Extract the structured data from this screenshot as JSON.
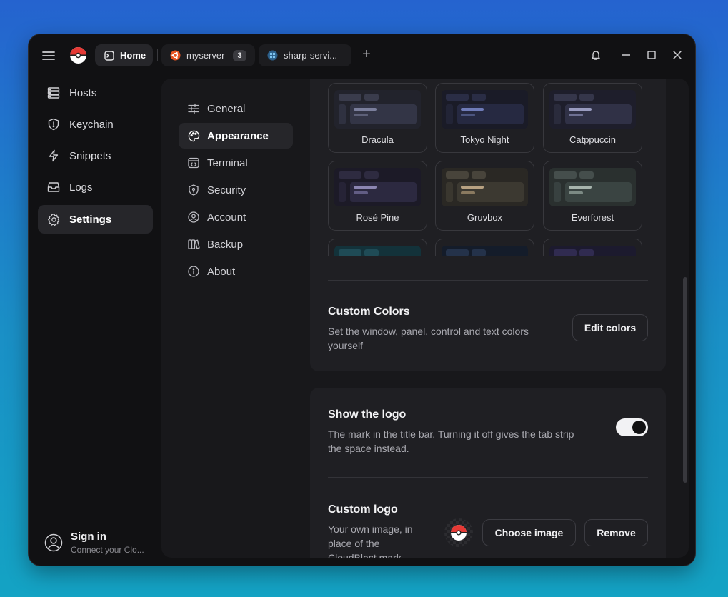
{
  "titlebar": {
    "tabs": [
      {
        "label": "Home",
        "icon": "terminal-square-icon"
      },
      {
        "label": "myserver",
        "icon": "ubuntu-icon",
        "badge": "3"
      },
      {
        "label": "sharp-servi...",
        "icon": "windows-icon"
      }
    ],
    "add_tab": "+"
  },
  "sidebar": {
    "items": [
      {
        "label": "Hosts",
        "icon": "server-icon"
      },
      {
        "label": "Keychain",
        "icon": "shield-icon"
      },
      {
        "label": "Snippets",
        "icon": "lightning-icon"
      },
      {
        "label": "Logs",
        "icon": "inbox-icon"
      },
      {
        "label": "Settings",
        "icon": "gear-icon",
        "active": true
      }
    ],
    "signin": {
      "title": "Sign in",
      "subtitle": "Connect your Clo..."
    }
  },
  "settings_nav": {
    "items": [
      {
        "label": "General",
        "icon": "sliders-icon"
      },
      {
        "label": "Appearance",
        "icon": "palette-icon",
        "active": true
      },
      {
        "label": "Terminal",
        "icon": "code-window-icon"
      },
      {
        "label": "Security",
        "icon": "shield-lock-icon"
      },
      {
        "label": "Account",
        "icon": "user-circle-icon"
      },
      {
        "label": "Backup",
        "icon": "book-icon"
      },
      {
        "label": "About",
        "icon": "info-icon"
      }
    ]
  },
  "themes": [
    {
      "name": "Dracula",
      "bg": "#22232c",
      "pill": "#3a3c4c",
      "side": "#2f3140",
      "content": "#333546",
      "line1": "#7b7f9c",
      "line2": "#5d6078"
    },
    {
      "name": "Tokyo Night",
      "bg": "#1a1b27",
      "pill": "#2a2d45",
      "side": "#222436",
      "content": "#262941",
      "line1": "#6f7bb7",
      "line2": "#4c557f"
    },
    {
      "name": "Catppuccin",
      "bg": "#1e1e2b",
      "pill": "#35364a",
      "side": "#2a2b3c",
      "content": "#303146",
      "line1": "#9a9cc0",
      "line2": "#6e7092"
    },
    {
      "name": "Rosé Pine",
      "bg": "#1c1a27",
      "pill": "#2e2b40",
      "side": "#262336",
      "content": "#2c2940",
      "line1": "#8c86b2",
      "line2": "#625d84"
    },
    {
      "name": "Gruvbox",
      "bg": "#2a2824",
      "pill": "#48443b",
      "side": "#3a372f",
      "content": "#3c3931",
      "line1": "#b8a282",
      "line2": "#8a7a60"
    },
    {
      "name": "Everforest",
      "bg": "#2a302f",
      "pill": "#454e4c",
      "side": "#384140",
      "content": "#3a4442",
      "line1": "#a7b4ad",
      "line2": "#7c8a84"
    },
    {
      "name": "",
      "bg": "#13323a",
      "pill": "#1f4b56",
      "side": "#19404a",
      "content": "#1d4550",
      "line1": "#4b8a96",
      "line2": "#366a74"
    },
    {
      "name": "",
      "bg": "#141c2a",
      "pill": "#24324a",
      "side": "#1c283c",
      "content": "#202c42",
      "line1": "#4d6a99",
      "line2": "#3a5178"
    },
    {
      "name": "",
      "bg": "#1c1a2e",
      "pill": "#302b50",
      "side": "#262242",
      "content": "#2a2648",
      "line1": "#6c63a8",
      "line2": "#514a86"
    }
  ],
  "custom_colors": {
    "title": "Custom Colors",
    "desc_line1": "Set the window, panel, control and text colors",
    "desc_line2": "yourself",
    "button": "Edit colors"
  },
  "show_logo": {
    "title": "Show the logo",
    "desc_line1": "The mark in the title bar. Turning it off gives the tab strip",
    "desc_line2": "the space instead.",
    "enabled": true
  },
  "custom_logo": {
    "title": "Custom logo",
    "desc_line1": "Your own image, in",
    "desc_line2": "place of the",
    "desc_line3": "CloudBlast mark.",
    "choose_button": "Choose image",
    "remove_button": "Remove"
  }
}
